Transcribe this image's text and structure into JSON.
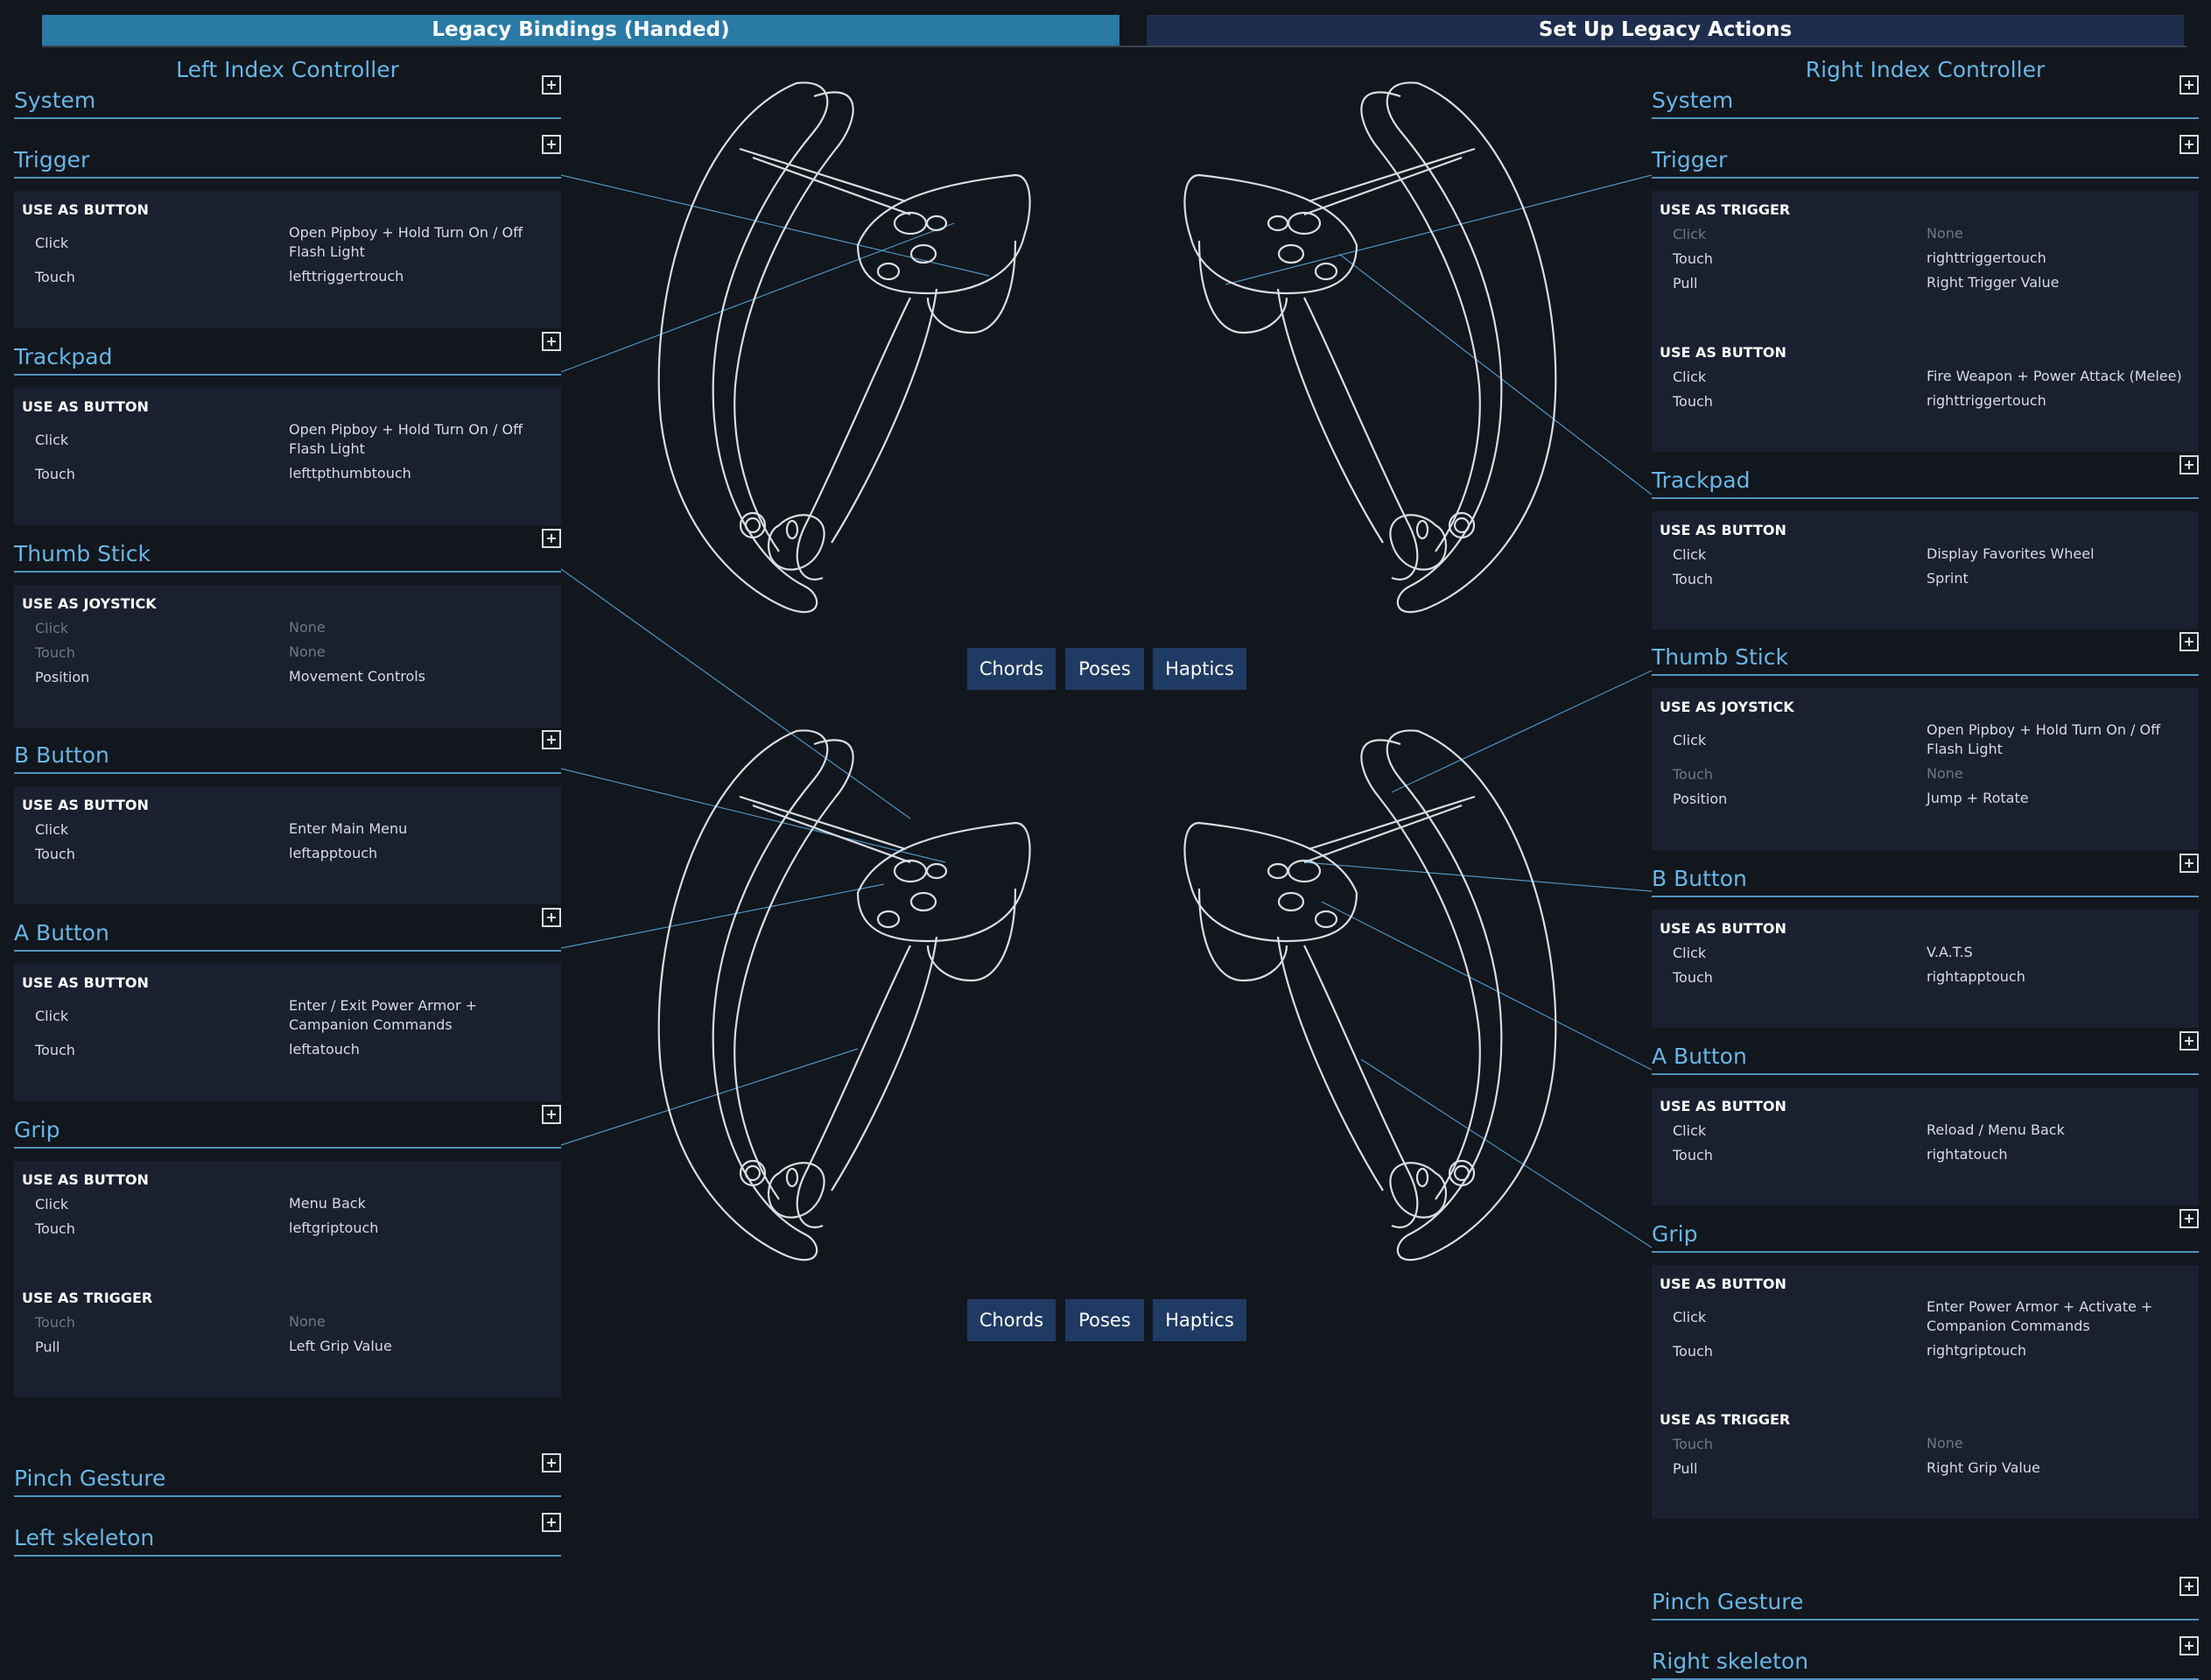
{
  "tabs": {
    "legacy_bindings": "Legacy Bindings (Handed)",
    "setup_legacy": "Set Up Legacy Actions"
  },
  "left": {
    "title": "Left Index Controller",
    "system": "System",
    "trigger": {
      "label": "Trigger",
      "group1": "USE AS BUTTON",
      "click_label": "Click",
      "click_value": "Open Pipboy + Hold Turn On / Off Flash Light",
      "touch_label": "Touch",
      "touch_value": "lefttriggertrouch"
    },
    "trackpad": {
      "label": "Trackpad",
      "group1": "USE AS BUTTON",
      "click_label": "Click",
      "click_value": "Open Pipboy + Hold Turn On / Off Flash Light",
      "touch_label": "Touch",
      "touch_value": "lefttpthumbtouch"
    },
    "thumbstick": {
      "label": "Thumb Stick",
      "group1": "USE AS JOYSTICK",
      "click_label": "Click",
      "click_value": "None",
      "touch_label": "Touch",
      "touch_value": "None",
      "position_label": "Position",
      "position_value": "Movement Controls"
    },
    "bbutton": {
      "label": "B Button",
      "group1": "USE AS BUTTON",
      "click_label": "Click",
      "click_value": "Enter Main Menu",
      "touch_label": "Touch",
      "touch_value": "leftapptouch"
    },
    "abutton": {
      "label": "A Button",
      "group1": "USE AS BUTTON",
      "click_label": "Click",
      "click_value": "Enter / Exit Power Armor + Campanion Commands",
      "touch_label": "Touch",
      "touch_value": "leftatouch"
    },
    "grip": {
      "label": "Grip",
      "group1": "USE AS BUTTON",
      "click_label": "Click",
      "click_value": "Menu Back",
      "touch_label": "Touch",
      "touch_value": "leftgriptouch",
      "group2": "USE AS TRIGGER",
      "t_touch_label": "Touch",
      "t_touch_value": "None",
      "pull_label": "Pull",
      "pull_value": "Left Grip Value"
    },
    "pinch": "Pinch Gesture",
    "skeleton": "Left skeleton"
  },
  "right": {
    "title": "Right Index Controller",
    "system": "System",
    "trigger": {
      "label": "Trigger",
      "group1": "USE AS TRIGGER",
      "click_label": "Click",
      "click_value": "None",
      "touch_label": "Touch",
      "touch_value": "righttriggertouch",
      "pull_label": "Pull",
      "pull_value": "Right Trigger Value",
      "group2": "USE AS BUTTON",
      "b_click_label": "Click",
      "b_click_value": "Fire Weapon + Power Attack (Melee)",
      "b_touch_label": "Touch",
      "b_touch_value": "righttriggertouch"
    },
    "trackpad": {
      "label": "Trackpad",
      "group1": "USE AS BUTTON",
      "click_label": "Click",
      "click_value": "Display Favorites Wheel",
      "touch_label": "Touch",
      "touch_value": "Sprint"
    },
    "thumbstick": {
      "label": "Thumb Stick",
      "group1": "USE AS JOYSTICK",
      "click_label": "Click",
      "click_value": "Open Pipboy + Hold Turn On / Off Flash Light",
      "touch_label": "Touch",
      "touch_value": "None",
      "position_label": "Position",
      "position_value": "Jump + Rotate"
    },
    "bbutton": {
      "label": "B Button",
      "group1": "USE AS BUTTON",
      "click_label": "Click",
      "click_value": "V.A.T.S",
      "touch_label": "Touch",
      "touch_value": "rightapptouch"
    },
    "abutton": {
      "label": "A Button",
      "group1": "USE AS BUTTON",
      "click_label": "Click",
      "click_value": "Reload / Menu Back",
      "touch_label": "Touch",
      "touch_value": "rightatouch"
    },
    "grip": {
      "label": "Grip",
      "group1": "USE AS BUTTON",
      "click_label": "Click",
      "click_value": "Enter Power Armor + Activate + Companion Commands",
      "touch_label": "Touch",
      "touch_value": "rightgriptouch",
      "group2": "USE AS TRIGGER",
      "t_touch_label": "Touch",
      "t_touch_value": "None",
      "pull_label": "Pull",
      "pull_value": "Right Grip Value"
    },
    "pinch": "Pinch Gesture",
    "skeleton": "Right skeleton"
  },
  "center": {
    "upper_buttons": [
      "Chords",
      "Poses",
      "Haptics"
    ],
    "lower_buttons": [
      "Chords",
      "Poses",
      "Haptics"
    ]
  },
  "colors": {
    "background": "#12161d",
    "accent_tab": "#2a7aa6",
    "inactive_tab": "#1e2d4d",
    "section_label": "#67b6e6",
    "box_bg": "#1b2030",
    "center_button": "#1f3a63"
  },
  "icons": {
    "add": "plus-square-icon"
  }
}
